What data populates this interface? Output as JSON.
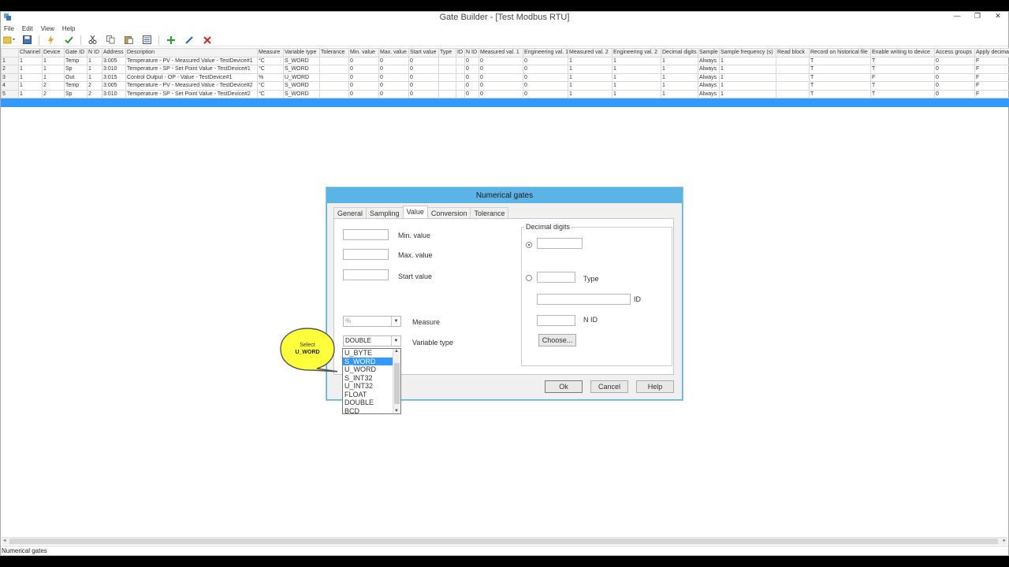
{
  "window": {
    "title": "Gate Builder - [Test Modbus RTU]"
  },
  "menu": [
    "File",
    "Edit",
    "View",
    "Help"
  ],
  "toolbar": {
    "icons": [
      "open-dropdown-icon",
      "save-icon",
      "lightning-icon",
      "check-icon",
      "cut-icon",
      "copy-icon",
      "paste-icon",
      "list-icon",
      "add-icon",
      "edit-icon",
      "delete-icon"
    ],
    "colors": {
      "add": "#2e9d2e",
      "delete": "#d62020",
      "edit": "#2a62c9",
      "check": "#2e9d2e"
    }
  },
  "grid": {
    "columns": [
      "",
      "Channel",
      "Device",
      "Gate ID",
      "N ID",
      "Address",
      "Description",
      "Measure",
      "Variable type",
      "Tolerance",
      "Min. value",
      "Max. value",
      "Start value",
      "Type",
      "ID",
      "N ID",
      "Measured val. 1",
      "Engineering val. 1",
      "Measured val. 2",
      "Engineering val. 2",
      "Decimal digits",
      "Sample",
      "Sample frequency (s)",
      "Read block",
      "Record on historical file",
      "Enable writing to device",
      "Access groups",
      "Apply decimal"
    ],
    "rows": [
      [
        "1",
        "1",
        "1",
        "Temp",
        "1",
        "3:005",
        "Temperature - PV - Measured Value - TestDevice#1",
        "°C",
        "S_WORD",
        "",
        "0",
        "0",
        "0",
        "",
        "",
        "0",
        "0",
        "0",
        "1",
        "1",
        "1",
        "Always",
        "1",
        "",
        "T",
        "T",
        "0",
        "F"
      ],
      [
        "2",
        "1",
        "1",
        "Sp",
        "1",
        "3:010",
        "Temperature - SP - Set Point Value - TestDevice#1",
        "°C",
        "S_WORD",
        "",
        "0",
        "0",
        "0",
        "",
        "",
        "0",
        "0",
        "0",
        "1",
        "1",
        "1",
        "Always",
        "1",
        "",
        "T",
        "T",
        "0",
        "F"
      ],
      [
        "3",
        "1",
        "1",
        "Out",
        "1",
        "3:015",
        "Control Output - OP - Value - TestDevice#1",
        "%",
        "U_WORD",
        "",
        "0",
        "0",
        "0",
        "",
        "",
        "0",
        "0",
        "0",
        "1",
        "1",
        "1",
        "Always",
        "1",
        "",
        "T",
        "F",
        "0",
        "F"
      ],
      [
        "4",
        "1",
        "2",
        "Temp",
        "2",
        "3:005",
        "Temperature - PV - Measured Value - TestDevice#2",
        "°C",
        "S_WORD",
        "",
        "0",
        "0",
        "0",
        "",
        "",
        "0",
        "0",
        "0",
        "1",
        "1",
        "1",
        "Always",
        "1",
        "",
        "T",
        "T",
        "0",
        "F"
      ],
      [
        "5",
        "1",
        "2",
        "Sp",
        "2",
        "3:010",
        "Temperature - SP - Set Point Value - TestDevice#2",
        "°C",
        "S_WORD",
        "",
        "0",
        "0",
        "0",
        "",
        "",
        "0",
        "0",
        "0",
        "1",
        "1",
        "1",
        "Always",
        "1",
        "",
        "T",
        "T",
        "0",
        "F"
      ]
    ]
  },
  "dialog": {
    "title": "Numerical gates",
    "tabs": [
      "General",
      "Sampling",
      "Value",
      "Conversion",
      "Tolerance"
    ],
    "labels": {
      "min": "Min. value",
      "max": "Max. value",
      "start": "Start value",
      "measure": "Measure",
      "vartype": "Variable type",
      "decimal_group": "Decimal digits",
      "type": "Type",
      "id": "ID",
      "nid": "N ID"
    },
    "measure_value": "%",
    "vartype_value": "DOUBLE",
    "buttons": {
      "choose": "Choose...",
      "ok": "Ok",
      "cancel": "Cancel",
      "help": "Help"
    }
  },
  "dropdown": {
    "options": [
      "U_BYTE",
      "S_WORD",
      "U_WORD",
      "S_INT32",
      "U_INT32",
      "FLOAT",
      "DOUBLE",
      "BCD"
    ],
    "highlighted": "S_WORD"
  },
  "callout": {
    "line1": "Select",
    "line2": "U_WORD",
    "color": "#ffff3c"
  },
  "status": {
    "text": "Numerical gates"
  }
}
